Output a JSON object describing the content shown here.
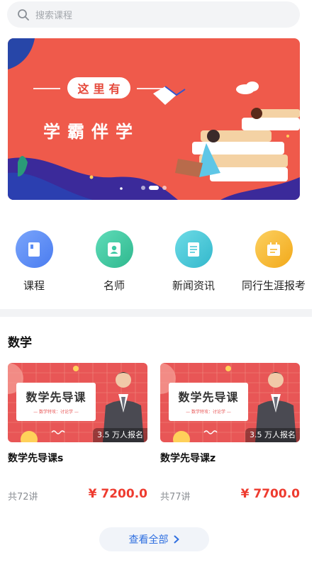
{
  "search": {
    "placeholder": "搜索课程"
  },
  "banner": {
    "badge": "这里有",
    "headline": "学霸伴学",
    "page_count": 3,
    "active_page": 1
  },
  "nav": [
    {
      "label": "课程",
      "icon": "book-icon",
      "color": "#5b8df5"
    },
    {
      "label": "名师",
      "icon": "teacher-icon",
      "color": "#3cc9a3"
    },
    {
      "label": "新闻资讯",
      "icon": "news-icon",
      "color": "#4cc9d9"
    },
    {
      "label": "同行生涯报考",
      "icon": "calendar-icon",
      "color": "#f7b932"
    }
  ],
  "section": {
    "title": "数学"
  },
  "courses": [
    {
      "thumb_title": "数学先导课",
      "thumb_subtitle": "— 数学特攻：讨论学 —",
      "enrolled": "3.5 万人报名",
      "name": "数学先导课s",
      "lessons": "共72讲",
      "price": "¥ 7200.0"
    },
    {
      "thumb_title": "数学先导课",
      "thumb_subtitle": "— 数学特攻：讨论学 —",
      "enrolled": "3.5 万人报名",
      "name": "数学先导课z",
      "lessons": "共77讲",
      "price": "¥ 7700.0"
    }
  ],
  "view_all": {
    "label": "查看全部"
  },
  "colors": {
    "accent": "#2f6fe0",
    "price": "#ee3b2f",
    "banner": "#ef5a4b"
  }
}
